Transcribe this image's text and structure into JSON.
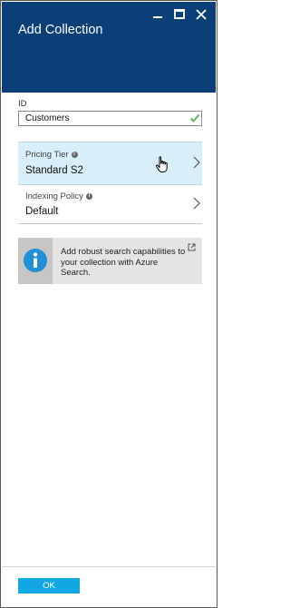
{
  "blade": {
    "title": "Add Collection",
    "header_color": "#0a3f78"
  },
  "window_controls": [
    "minimize-icon",
    "maximize-icon",
    "close-icon"
  ],
  "id_field": {
    "label": "ID",
    "value": "Customers",
    "valid_icon": "check-icon",
    "valid_color": "#5cb85c"
  },
  "pricing_tier": {
    "label": "Pricing Tier",
    "value": "Standard S2",
    "selected": true,
    "highlight_color": "#d8eef8"
  },
  "indexing_policy": {
    "label": "Indexing Policy",
    "value": "Default"
  },
  "promo": {
    "text": "Add robust search capabilities to your collection with Azure Search.",
    "icon": "info-icon",
    "icon_color": "#1f8fd6",
    "link_icon": "external-link-icon"
  },
  "footer": {
    "ok_label": "OK",
    "ok_color": "#12a7e3"
  }
}
